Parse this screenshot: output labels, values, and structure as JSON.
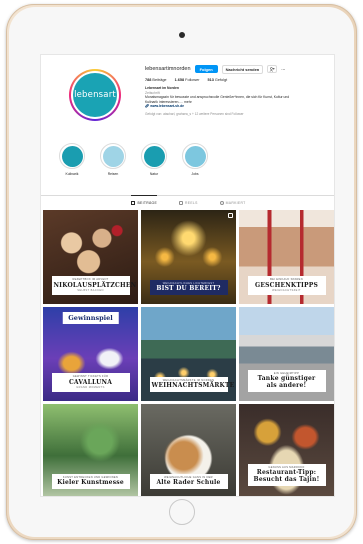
{
  "profile": {
    "username": "lebensartimnorden",
    "avatar_text": "lebensart",
    "buttons": {
      "follow": "Folgen",
      "message": "Nachricht senden",
      "more": "..."
    },
    "stats": [
      {
        "count": "788",
        "label": "Beiträge"
      },
      {
        "count": "1.658",
        "label": "Follower"
      },
      {
        "count": "513",
        "label": "Gefolgt"
      }
    ],
    "bio": {
      "name": "Lebensart im Norden",
      "category": "Zeitschrift",
      "line1": "Monatsmagazin für bewusste und anspruchsvolle Genießer*innen, die sich für Kunst, Kultur und",
      "line2": "Kulinarik interessieren..... mehr",
      "link": "www.lebensart-sh.de"
    },
    "followed_by": "Gefolgt von: atacharl, grahsea_s + 12 weitere Personen sind Follower"
  },
  "highlights": [
    {
      "label": "Kulinarik",
      "color": "#1a9db0"
    },
    {
      "label": "Reisen",
      "color": "#9fd4e6"
    },
    {
      "label": "Natur",
      "color": "#1a9db0"
    },
    {
      "label": "Jobs",
      "color": "#7dc7df"
    }
  ],
  "tabs": [
    {
      "label": "BEITRÄGE",
      "active": true
    },
    {
      "label": "REELS",
      "active": false
    },
    {
      "label": "MARKIERT",
      "active": false
    }
  ],
  "posts": [
    {
      "kicker": "Rezeptbox im Advent",
      "headline": "NIKOLAUSPLÄTZCHEN",
      "subline": "Selbst backen",
      "dark": false
    },
    {
      "kicker": "Weihnachtliches Lichterfest",
      "headline": "BIST DU BEREIT?",
      "subline": "",
      "dark": true
    },
    {
      "kicker": "Bei Einkauf Sparen",
      "headline": "GESCHENKTIPPS",
      "subline": "Weihnachtszeit",
      "dark": false
    },
    {
      "top_title": "Gewinnspiel",
      "kicker": "Gewinnt Tickets für",
      "headline": "CAVALLUNA",
      "subline": "Grand Moments",
      "dark": false
    },
    {
      "kicker": "Weihnachtsmärkte im Norden",
      "headline": "WEIHNACHTSMÄRKTE",
      "subline": "",
      "dark": false
    },
    {
      "kicker": "Ein Geheimtipp",
      "headline": "Tanke günstiger",
      "subline": "als andere!",
      "dark": false
    },
    {
      "kicker": "Kunst entdecken und Gewinnen",
      "headline": "Kieler Kunstmesse",
      "subline": "",
      "dark": false
    },
    {
      "kicker": "Weihnachtliche Gans in der",
      "headline": "Alte Rader Schule",
      "subline": "",
      "dark": false
    },
    {
      "kicker": "Genuss aus Marokko",
      "headline": "Restaurant-Tipp:",
      "subline": "Besucht das Tajin!",
      "dark": false
    }
  ]
}
